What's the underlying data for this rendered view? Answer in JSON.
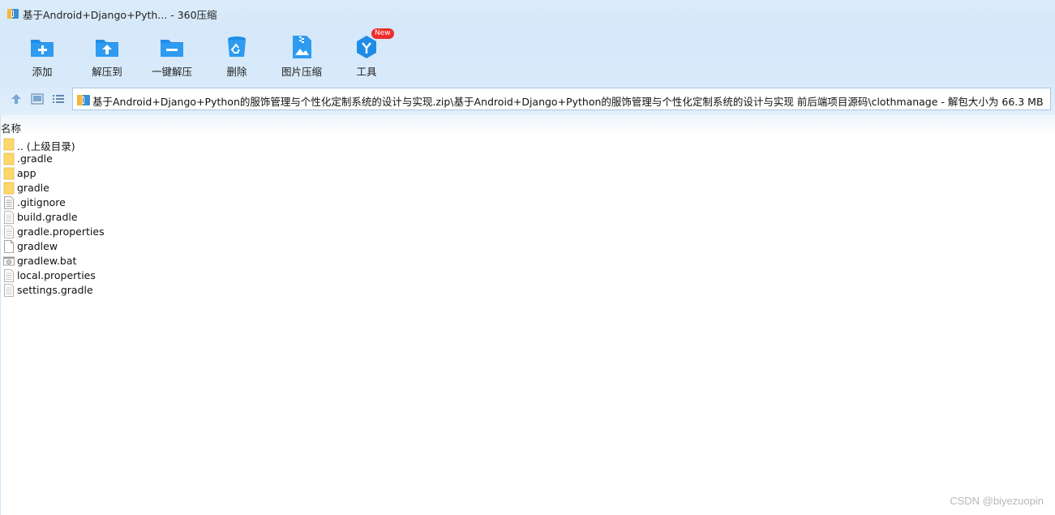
{
  "window": {
    "title": "基于Android+Django+Pyth...",
    "separator": " - ",
    "app_name": "360压缩"
  },
  "toolbar": {
    "items": [
      {
        "label": "添加",
        "icon": "add-folder-icon"
      },
      {
        "label": "解压到",
        "icon": "extract-to-icon"
      },
      {
        "label": "一键解压",
        "icon": "one-click-extract-icon"
      },
      {
        "label": "删除",
        "icon": "delete-icon"
      },
      {
        "label": "图片压缩",
        "icon": "image-compress-icon"
      },
      {
        "label": "工具",
        "icon": "tools-icon",
        "badge": "New"
      }
    ]
  },
  "nav": {
    "up_icon": "up-arrow-icon",
    "thumb_view_icon": "thumbnail-view-icon",
    "list_view_icon": "list-view-icon"
  },
  "address": {
    "path": "基于Android+Django+Python的服饰管理与个性化定制系统的设计与实现.zip\\基于Android+Django+Python的服饰管理与个性化定制系统的设计与实现 前后端项目源码\\clothmanage - 解包大小为 66.3 MB"
  },
  "list": {
    "column_name": "名称",
    "items": [
      {
        "name": ".. (上级目录)",
        "type": "folder"
      },
      {
        "name": ".gradle",
        "type": "folder"
      },
      {
        "name": "app",
        "type": "folder"
      },
      {
        "name": "gradle",
        "type": "folder"
      },
      {
        "name": ".gitignore",
        "type": "text"
      },
      {
        "name": "build.gradle",
        "type": "text"
      },
      {
        "name": "gradle.properties",
        "type": "text"
      },
      {
        "name": "gradlew",
        "type": "blank"
      },
      {
        "name": "gradlew.bat",
        "type": "bat"
      },
      {
        "name": "local.properties",
        "type": "text"
      },
      {
        "name": "settings.gradle",
        "type": "text"
      }
    ]
  },
  "watermark": "CSDN @biyezuopin",
  "colors": {
    "toolbar_blue": "#1f8ce6",
    "titlebar_bg": "#dcecfa",
    "badge_red": "#f02c2c",
    "folder_yellow": "#ffd86b"
  }
}
